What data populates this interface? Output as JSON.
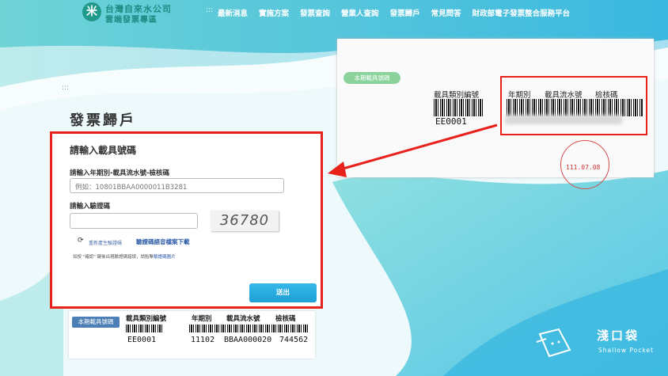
{
  "header": {
    "logo_line1": "台灣自來水公司",
    "logo_line2": "雲端發票專區",
    "logo_mark": "米",
    "nav_dots": ":::",
    "nav": [
      "最新消息",
      "實施方案",
      "發票查詢",
      "營業人查詢",
      "發票歸戶",
      "常見問答",
      "財政部電子發票整合服務平台"
    ]
  },
  "breadcrumb_dots": ":::",
  "page_title": "發票歸戶",
  "form": {
    "title": "請輸入載具號碼",
    "label_carrier": "請輸入年期別-載具流水號-檢核碼",
    "carrier_placeholder": "例如：10801BBAA0000011B3281",
    "label_captcha": "請輸入驗證碼",
    "captcha_value": "36780",
    "refresh_text": "重新產生驗證碼",
    "audio_link": "驗證碼語音檔案下載",
    "hint_prefix": "如按 \"確認\" 鍵後出現驗證碼錯誤，請點擊",
    "hint_link": "驗證碼圖片",
    "submit": "送出"
  },
  "barcode_strip": {
    "tag": "本期載具號碼",
    "col1_header": "載具類別編號",
    "col2_header": "年期別",
    "col3_header": "載具流水號",
    "col4_header": "檢核碼",
    "col1_value": "EE0001",
    "col2_value": "11102",
    "col3_value": "BBAA000020",
    "col4_value": "744562"
  },
  "photo": {
    "tag": "本期載具號碼",
    "col1_header": "載具類別編號",
    "col2_header": "年期別",
    "col3_header": "載具流水號",
    "col4_header": "檢核碼",
    "col1_value": "EE0001",
    "stamp_date": "111.07.08"
  },
  "watermark": {
    "brand_cn": "淺口袋",
    "brand_en": "Shallow Pocket"
  },
  "colors": {
    "accent_red": "#e8221b",
    "submit_blue": "#1ea0d6",
    "teal": "#1e8b83"
  }
}
